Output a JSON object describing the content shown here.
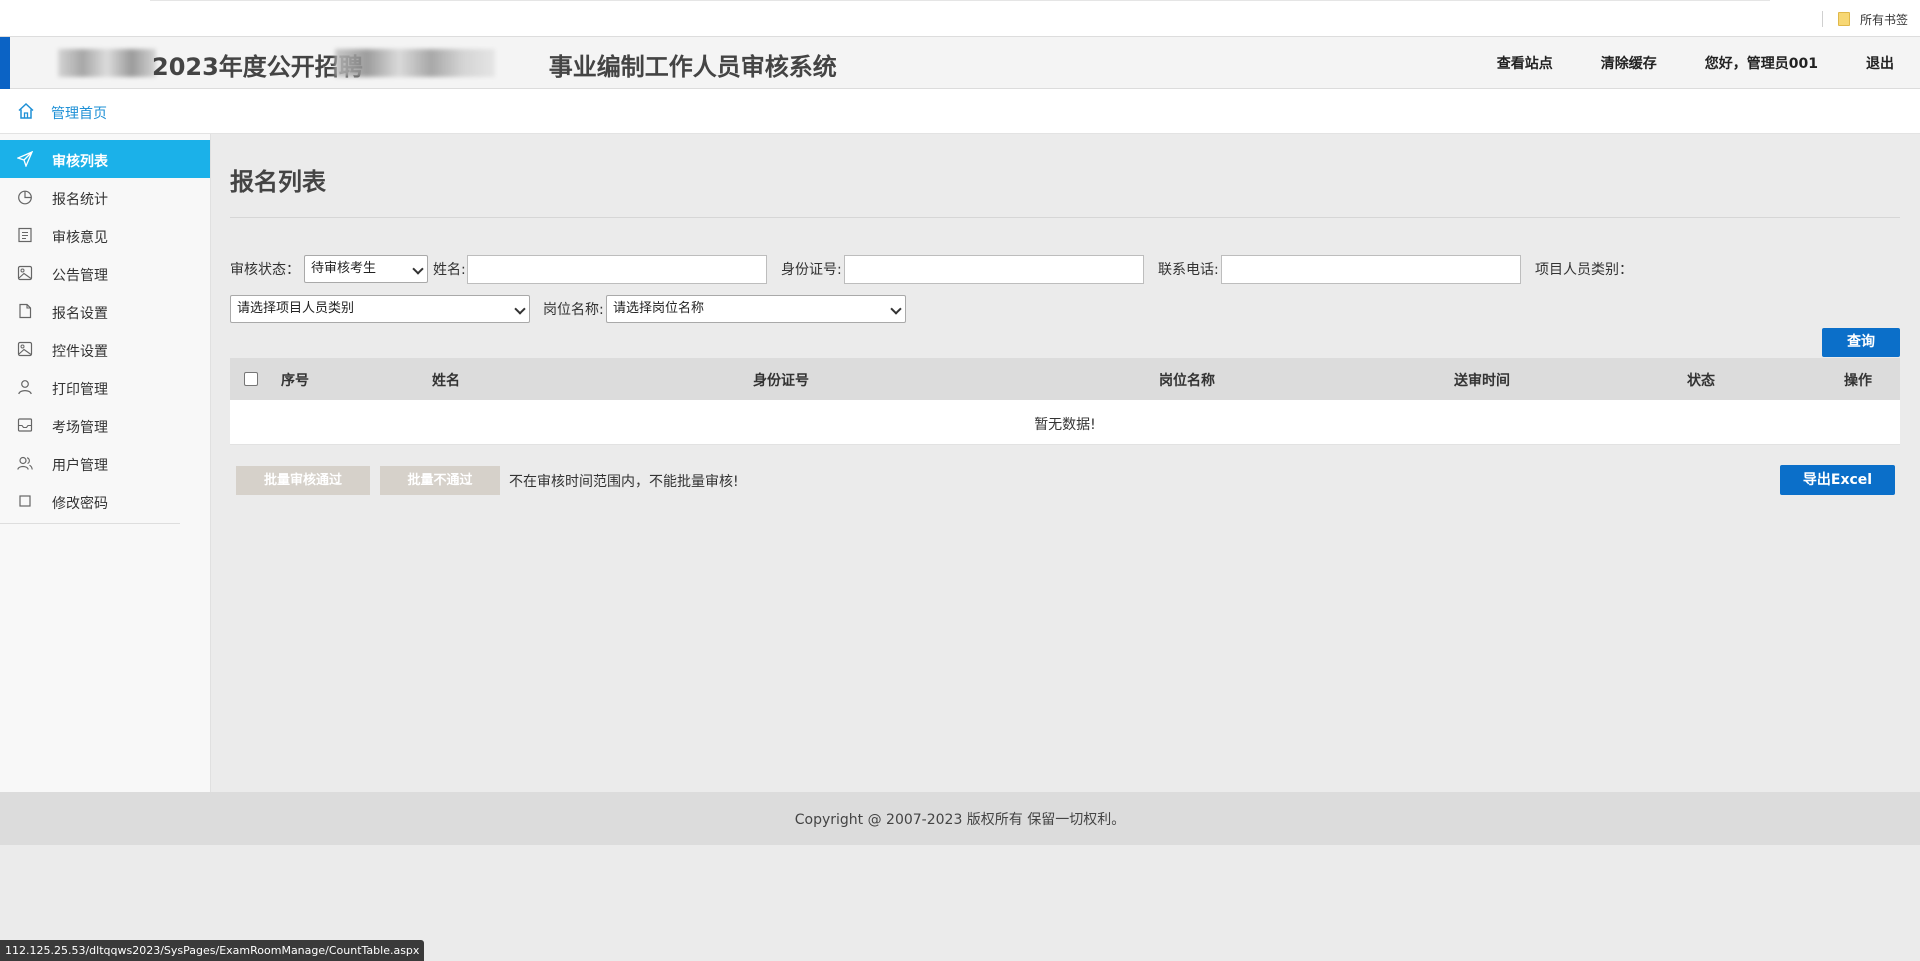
{
  "browser": {
    "bookmarks_folder": "所有书签",
    "status_url": "112.125.25.53/dltqqws2023/SysPages/ExamRoomManage/CountTable.aspx"
  },
  "header": {
    "title_part1": "2023年度公开招聘",
    "title_part2": "事业编制工作人员审核系统",
    "nav": {
      "view_site": "查看站点",
      "clear_cache": "清除缓存",
      "greeting": "您好，管理员001",
      "logout": "退出"
    }
  },
  "home": {
    "label": "管理首页"
  },
  "sidebar": {
    "items": [
      {
        "label": "审核列表",
        "icon": "send-icon",
        "active": true
      },
      {
        "label": "报名统计",
        "icon": "pie-chart-icon"
      },
      {
        "label": "审核意见",
        "icon": "document-icon"
      },
      {
        "label": "公告管理",
        "icon": "image-icon"
      },
      {
        "label": "报名设置",
        "icon": "file-icon"
      },
      {
        "label": "控件设置",
        "icon": "image-icon"
      },
      {
        "label": "打印管理",
        "icon": "user-icon"
      },
      {
        "label": "考场管理",
        "icon": "inbox-icon"
      },
      {
        "label": "用户管理",
        "icon": "users-icon"
      },
      {
        "label": "修改密码",
        "icon": "square-icon"
      }
    ]
  },
  "main": {
    "page_title": "报名列表",
    "filters": {
      "status_label": "审核状态：",
      "status_value": "待审核考生",
      "name_label": "姓名:",
      "name_value": "",
      "id_label": "身份证号:",
      "id_value": "",
      "phone_label": "联系电话:",
      "phone_value": "",
      "category_label": "项目人员类别：",
      "category_value": "请选择项目人员类别",
      "position_label": "岗位名称:",
      "position_value": "请选择岗位名称"
    },
    "query_button": "查询",
    "table": {
      "columns": [
        "序号",
        "姓名",
        "身份证号",
        "岗位名称",
        "送审时间",
        "状态",
        "操作"
      ],
      "empty_text": "暂无数据!"
    },
    "batch_pass_button": "批量审核通过",
    "batch_fail_button": "批量不通过",
    "notice": "不在审核时间范围内，不能批量审核!",
    "export_button": "导出Excel"
  },
  "footer": {
    "copyright": "Copyright @ 2007-2023  版权所有 保留一切权利。"
  },
  "colors": {
    "accent_blue": "#0b63c5",
    "sidebar_active": "#1bb1e9",
    "button_blue": "#0b6fc9",
    "button_disabled": "#d6d1ca",
    "link_blue": "#1e90d6"
  }
}
